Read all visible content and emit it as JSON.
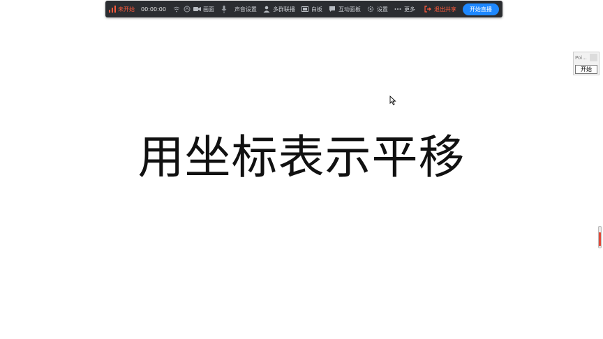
{
  "toolbar": {
    "status_label": "未开始",
    "timer": "00:00:00",
    "items": {
      "camera": "画面",
      "audio_settings": "声音设置",
      "multi_co_stream": "多群联播",
      "whiteboard": "白板",
      "interactive_panel": "互动面板",
      "settings": "设置",
      "more": "更多"
    },
    "exit_share_label": "退出共享",
    "start_live_label": "开始直播"
  },
  "slide": {
    "title": "用坐标表示平移"
  },
  "mini_widget": {
    "title": "Poi...",
    "button_label": "开始"
  },
  "colors": {
    "toolbar_bg": "#2b2d31",
    "accent_red": "#ff5a3c",
    "primary_blue": "#1e88ff"
  }
}
